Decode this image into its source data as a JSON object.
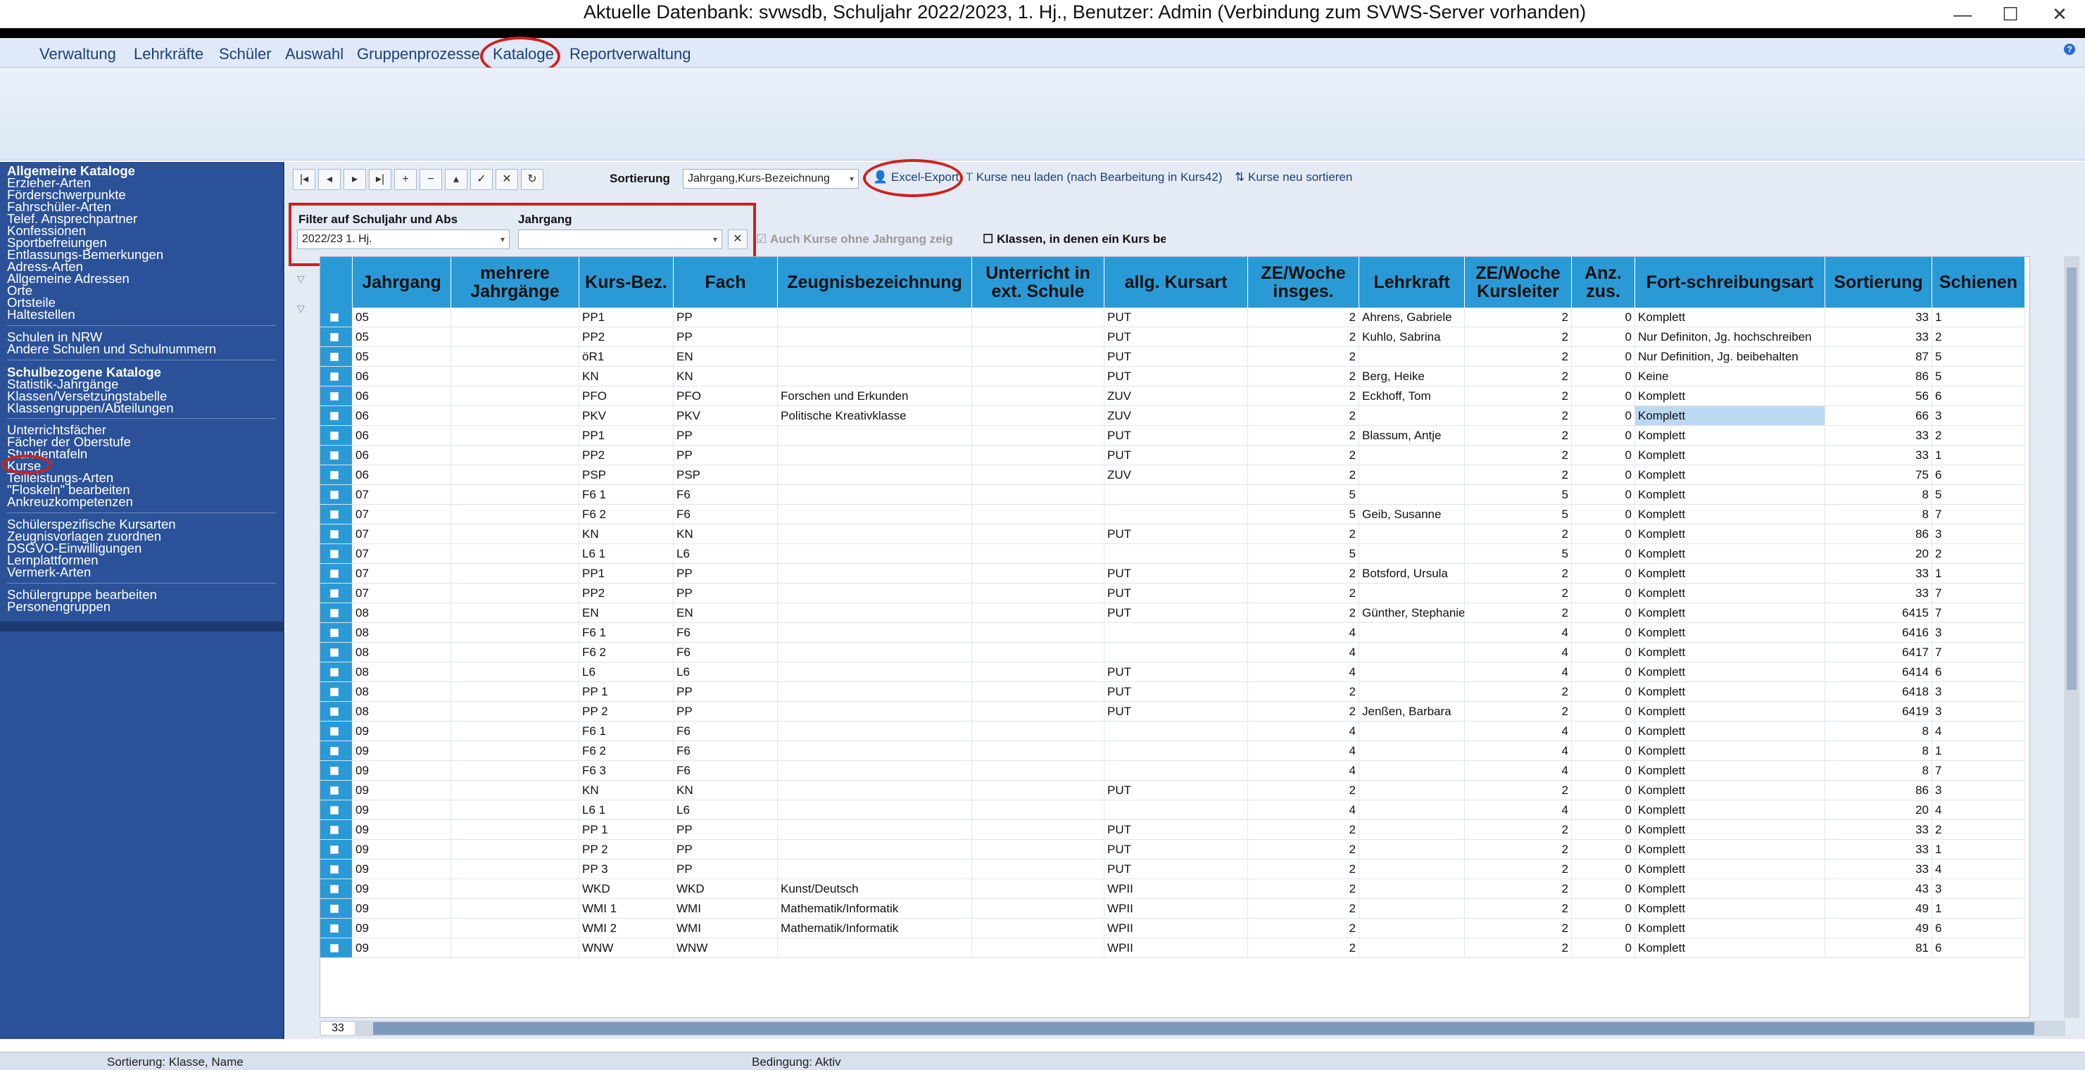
{
  "window": {
    "title": "Aktuelle Datenbank: svwsdb, Schuljahr 2022/2023, 1. Hj., Benutzer: Admin (Verbindung zum SVWS-Server vorhanden)",
    "minimize": "—",
    "maximize": "☐",
    "close": "✕"
  },
  "menu": [
    "Verwaltung",
    "Lehrkräfte",
    "Schüler",
    "Auswahl",
    "Gruppenprozesse",
    "Kataloge",
    "Reportverwaltung"
  ],
  "help": "?",
  "sidebar": {
    "allgemein_heading": "Allgemeine Kataloge",
    "allgemein": [
      "Erzieher-Arten",
      "Förderschwerpunkte",
      "Fahrschüler-Arten",
      "Telef. Ansprechpartner",
      "Konfessionen",
      "Sportbefreiungen",
      "Entlassungs-Bemerkungen",
      "Adress-Arten",
      "Allgemeine Adressen",
      "Orte",
      "Ortsteile",
      "Haltestellen"
    ],
    "nrw": [
      "Schulen in NRW",
      "Andere Schulen und Schulnummern"
    ],
    "schulbezogen_heading": "Schulbezogene Kataloge",
    "schulbezogen": [
      "Statistik-Jahrgänge",
      "Klassen/Versetzungstabelle",
      "Klassengruppen/Abteilungen"
    ],
    "unterricht": [
      "Unterrichtsfächer",
      "Fächer der Oberstufe",
      "Stundentafeln",
      "Kurse",
      "Teilleistungs-Arten",
      "\"Floskeln\" bearbeiten",
      "Ankreuzkompetenzen"
    ],
    "schueler": [
      "Schülerspezifische Kursarten",
      "Zeugnisvorlagen zuordnen",
      "DSGVO-Einwilligungen",
      "Lernplattformen",
      "Vermerk-Arten"
    ],
    "gruppen": [
      "Schülergruppe bearbeiten",
      "Personengruppen"
    ]
  },
  "toolbar": {
    "nav": [
      "|◂",
      "◂",
      "▸",
      "▸|",
      "+",
      "−",
      "▴",
      "✓",
      "✕",
      "↻"
    ],
    "sortierung_label": "Sortierung",
    "sortierung_value": "Jahrgang,Kurs-Bezeichnung",
    "excel_export": "Excel-Export",
    "reload": "Kurse neu laden (nach Bearbeitung in Kurs42)",
    "resort": "Kurse neu sortieren"
  },
  "filter": {
    "schuljahr_label": "Filter auf Schuljahr und Abs",
    "schuljahr_value": "2022/23 1. Hj.",
    "jahrgang_label": "Jahrgang",
    "jahrgang_value": "",
    "clear": "✕",
    "ohne_jahrgang": "Auch Kurse ohne Jahrgang zeig",
    "klassen": "Klassen, in denen ein Kurs belegt ist, anzeig"
  },
  "grid": {
    "columns": [
      "Jahrgang",
      "mehrere Jahrgänge",
      "Kurs-Bez.",
      "Fach",
      "Zeugnisbezeichnung",
      "Unterricht in ext. Schule",
      "allg. Kursart",
      "ZE/Woche insges.",
      "Lehrkraft",
      "ZE/Woche Kursleiter",
      "Anz. zus.",
      "Fort-schreibungsart",
      "Sortierung",
      "Schienen"
    ],
    "rows": [
      [
        "05",
        "",
        "PP1",
        "PP",
        "",
        "",
        "PUT",
        "2",
        "Ahrens, Gabriele",
        "2",
        "0",
        "Komplett",
        "33",
        "1"
      ],
      [
        "05",
        "",
        "PP2",
        "PP",
        "",
        "",
        "PUT",
        "2",
        "Kuhlo, Sabrina",
        "2",
        "0",
        "Nur Definiton, Jg. hochschreiben",
        "33",
        "2"
      ],
      [
        "05",
        "",
        "öR1",
        "EN",
        "",
        "",
        "PUT",
        "2",
        "",
        "2",
        "0",
        "Nur Definition, Jg. beibehalten",
        "87",
        "5"
      ],
      [
        "06",
        "",
        "KN",
        "KN",
        "",
        "",
        "PUT",
        "2",
        "Berg, Heike",
        "2",
        "0",
        "Keine",
        "86",
        "5"
      ],
      [
        "06",
        "",
        "PFO",
        "PFO",
        "Forschen und Erkunden",
        "",
        "ZUV",
        "2",
        "Eckhoff, Tom",
        "2",
        "0",
        "Komplett",
        "56",
        "6"
      ],
      [
        "06",
        "",
        "PKV",
        "PKV",
        "Politische Kreativklasse",
        "",
        "ZUV",
        "2",
        "",
        "2",
        "0",
        "Komplett",
        "66",
        "3"
      ],
      [
        "06",
        "",
        "PP1",
        "PP",
        "",
        "",
        "PUT",
        "2",
        "Blassum, Antje",
        "2",
        "0",
        "Komplett",
        "33",
        "2"
      ],
      [
        "06",
        "",
        "PP2",
        "PP",
        "",
        "",
        "PUT",
        "2",
        "",
        "2",
        "0",
        "Komplett",
        "33",
        "1"
      ],
      [
        "06",
        "",
        "PSP",
        "PSP",
        "",
        "",
        "ZUV",
        "2",
        "",
        "2",
        "0",
        "Komplett",
        "75",
        "6"
      ],
      [
        "07",
        "",
        "F6 1",
        "F6",
        "",
        "",
        "",
        "5",
        "",
        "5",
        "0",
        "Komplett",
        "8",
        "5"
      ],
      [
        "07",
        "",
        "F6 2",
        "F6",
        "",
        "",
        "",
        "5",
        "Geib, Susanne",
        "5",
        "0",
        "Komplett",
        "8",
        "7"
      ],
      [
        "07",
        "",
        "KN",
        "KN",
        "",
        "",
        "PUT",
        "2",
        "",
        "2",
        "0",
        "Komplett",
        "86",
        "3"
      ],
      [
        "07",
        "",
        "L6 1",
        "L6",
        "",
        "",
        "",
        "5",
        "",
        "5",
        "0",
        "Komplett",
        "20",
        "2"
      ],
      [
        "07",
        "",
        "PP1",
        "PP",
        "",
        "",
        "PUT",
        "2",
        "Botsford, Ursula",
        "2",
        "0",
        "Komplett",
        "33",
        "1"
      ],
      [
        "07",
        "",
        "PP2",
        "PP",
        "",
        "",
        "PUT",
        "2",
        "",
        "2",
        "0",
        "Komplett",
        "33",
        "7"
      ],
      [
        "08",
        "",
        "EN",
        "EN",
        "",
        "",
        "PUT",
        "2",
        "Günther, Stephanie",
        "2",
        "0",
        "Komplett",
        "6415",
        "7"
      ],
      [
        "08",
        "",
        "F6 1",
        "F6",
        "",
        "",
        "",
        "4",
        "",
        "4",
        "0",
        "Komplett",
        "6416",
        "3"
      ],
      [
        "08",
        "",
        "F6 2",
        "F6",
        "",
        "",
        "",
        "4",
        "",
        "4",
        "0",
        "Komplett",
        "6417",
        "7"
      ],
      [
        "08",
        "",
        "L6",
        "L6",
        "",
        "",
        "PUT",
        "4",
        "",
        "4",
        "0",
        "Komplett",
        "6414",
        "6"
      ],
      [
        "08",
        "",
        "PP 1",
        "PP",
        "",
        "",
        "PUT",
        "2",
        "",
        "2",
        "0",
        "Komplett",
        "6418",
        "3"
      ],
      [
        "08",
        "",
        "PP 2",
        "PP",
        "",
        "",
        "PUT",
        "2",
        "Jenßen, Barbara",
        "2",
        "0",
        "Komplett",
        "6419",
        "3"
      ],
      [
        "09",
        "",
        "F6 1",
        "F6",
        "",
        "",
        "",
        "4",
        "",
        "4",
        "0",
        "Komplett",
        "8",
        "4"
      ],
      [
        "09",
        "",
        "F6 2",
        "F6",
        "",
        "",
        "",
        "4",
        "",
        "4",
        "0",
        "Komplett",
        "8",
        "1"
      ],
      [
        "09",
        "",
        "F6 3",
        "F6",
        "",
        "",
        "",
        "4",
        "",
        "4",
        "0",
        "Komplett",
        "8",
        "7"
      ],
      [
        "09",
        "",
        "KN",
        "KN",
        "",
        "",
        "PUT",
        "2",
        "",
        "2",
        "0",
        "Komplett",
        "86",
        "3"
      ],
      [
        "09",
        "",
        "L6 1",
        "L6",
        "",
        "",
        "",
        "4",
        "",
        "4",
        "0",
        "Komplett",
        "20",
        "4"
      ],
      [
        "09",
        "",
        "PP 1",
        "PP",
        "",
        "",
        "PUT",
        "2",
        "",
        "2",
        "0",
        "Komplett",
        "33",
        "2"
      ],
      [
        "09",
        "",
        "PP 2",
        "PP",
        "",
        "",
        "PUT",
        "2",
        "",
        "2",
        "0",
        "Komplett",
        "33",
        "1"
      ],
      [
        "09",
        "",
        "PP 3",
        "PP",
        "",
        "",
        "PUT",
        "2",
        "",
        "2",
        "0",
        "Komplett",
        "33",
        "4"
      ],
      [
        "09",
        "",
        "WKD",
        "WKD",
        "Kunst/Deutsch",
        "",
        "WPII",
        "2",
        "",
        "2",
        "0",
        "Komplett",
        "43",
        "3"
      ],
      [
        "09",
        "",
        "WMI 1",
        "WMI",
        "Mathematik/Informatik",
        "",
        "WPII",
        "2",
        "",
        "2",
        "0",
        "Komplett",
        "49",
        "1"
      ],
      [
        "09",
        "",
        "WMI 2",
        "WMI",
        "Mathematik/Informatik",
        "",
        "WPII",
        "2",
        "",
        "2",
        "0",
        "Komplett",
        "49",
        "6"
      ],
      [
        "09",
        "",
        "WNW",
        "WNW",
        "",
        "",
        "WPII",
        "2",
        "",
        "2",
        "0",
        "Komplett",
        "81",
        "6"
      ]
    ],
    "row_count": "33"
  },
  "status": {
    "sortierung": "Sortierung: Klasse, Name",
    "bedingung": "Bedingung: Aktiv"
  },
  "colors": {
    "header": "#2a9ad6",
    "sidebar": "#2b5298",
    "highlight": "#d0201c",
    "selected_cell": "#bcd9f2"
  }
}
